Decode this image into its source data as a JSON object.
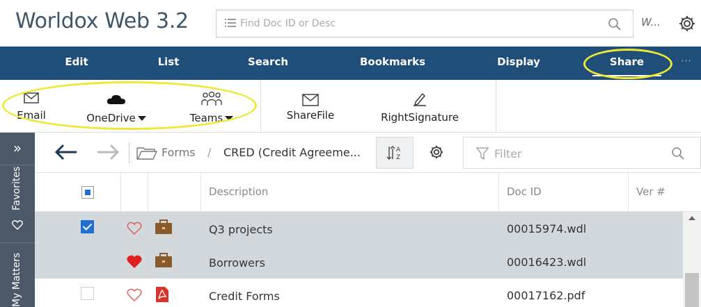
{
  "app": {
    "title": "Worldox Web 3.2"
  },
  "search": {
    "placeholder": "Find Doc ID or Desc"
  },
  "user": {
    "abbrev": "W..."
  },
  "menu": {
    "items": [
      {
        "label": "Edit",
        "active": false
      },
      {
        "label": "List",
        "active": false
      },
      {
        "label": "Search",
        "active": false
      },
      {
        "label": "Bookmarks",
        "active": false
      },
      {
        "label": "Display",
        "active": false
      },
      {
        "label": "Share",
        "active": true
      }
    ],
    "more": "···"
  },
  "ribbon": {
    "email": "Email",
    "onedrive": "OneDrive",
    "teams": "Teams",
    "sharefile": "ShareFile",
    "rightsignature": "RightSignature"
  },
  "side": {
    "expand": "»",
    "favorites": "Favorites",
    "matters": "My Matters"
  },
  "nav": {
    "crumb_root": "Forms",
    "crumb_sep": "/",
    "crumb_current": "CRED (Credit Agreeme..."
  },
  "filter": {
    "placeholder": "Filter"
  },
  "table": {
    "headers": {
      "description": "Description",
      "doc_id": "Doc ID",
      "version": "Ver #"
    },
    "rows": [
      {
        "checked": true,
        "favorite": false,
        "type": "briefcase-icon",
        "description": "Q3 projects",
        "doc_id": "00015974.wdl"
      },
      {
        "checked": false,
        "favorite": true,
        "type": "briefcase-icon",
        "description": "Borrowers",
        "doc_id": "00016423.wdl"
      },
      {
        "checked": false,
        "favorite": false,
        "type": "pdf-icon",
        "description": "Credit Forms",
        "doc_id": "00017162.pdf"
      }
    ]
  },
  "colors": {
    "menubar": "#1f4e79",
    "sidebar": "#4a5868",
    "highlight": "#f0e836",
    "selected_row": "#d3d8dd",
    "heart_red": "#e02020",
    "briefcase": "#8b5a2b",
    "pdf_red": "#d9342b"
  }
}
